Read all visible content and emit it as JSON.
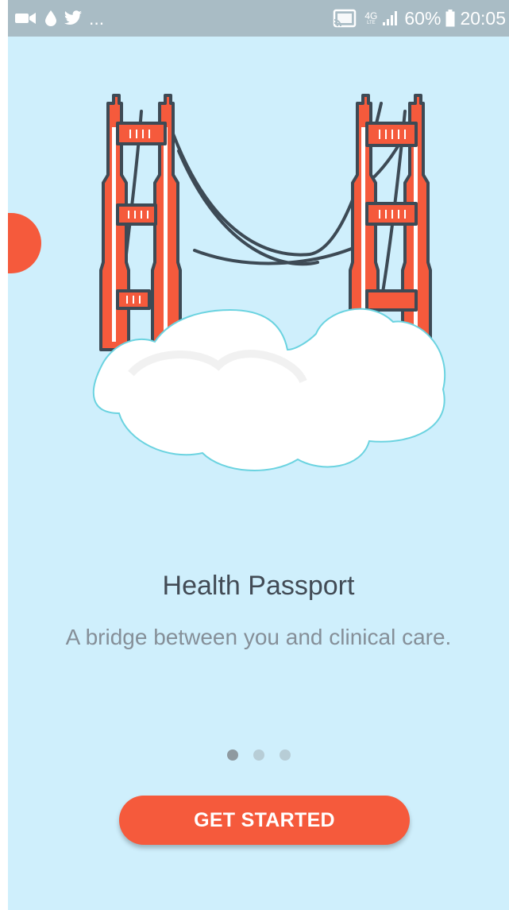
{
  "status_bar": {
    "left_overflow": "...",
    "network_type_top": "4G",
    "network_type_bottom": "LTE",
    "battery_percent": "60%",
    "time": "20:05",
    "icons": [
      "video-camera-icon",
      "water-drop-icon",
      "twitter-bird-icon",
      "cast-icon",
      "signal-icon",
      "battery-icon"
    ]
  },
  "onboarding": {
    "title": "Health Passport",
    "subtitle": "A bridge between you and clinical care.",
    "page_count": 3,
    "active_page": 1,
    "cta_label": "GET STARTED"
  },
  "colors": {
    "background": "#cfeffc",
    "accent": "#f55a3c",
    "status_bar": "#a9bcc5",
    "title": "#424b55",
    "subtitle": "#858f98"
  }
}
